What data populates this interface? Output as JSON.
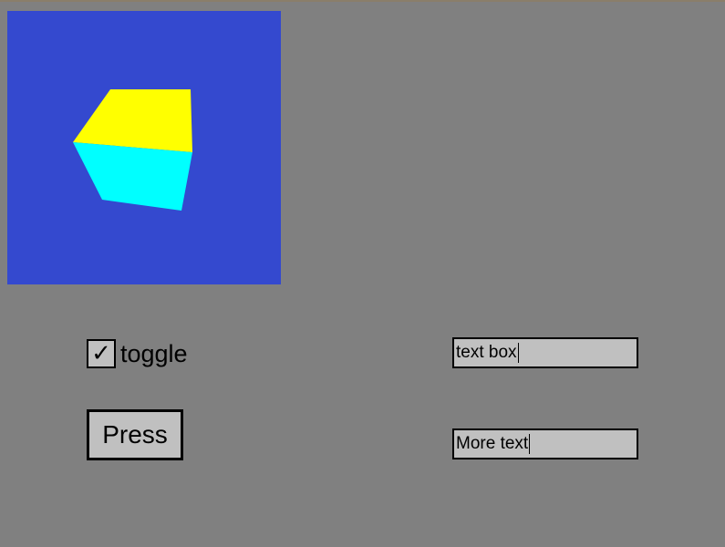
{
  "viewport": {
    "background": "#3449cf",
    "cube_colors": {
      "top_face": "#ffff00",
      "front_face": "#00ffff"
    }
  },
  "controls": {
    "toggle": {
      "label": "toggle",
      "checked": true,
      "check_glyph": "✓"
    },
    "press_button": {
      "label": "Press"
    },
    "text_box_1": {
      "value": "text box"
    },
    "text_box_2": {
      "value": "More text"
    }
  },
  "colors": {
    "background": "#808080",
    "control_fill": "#c0c0c0",
    "border": "#000000"
  }
}
